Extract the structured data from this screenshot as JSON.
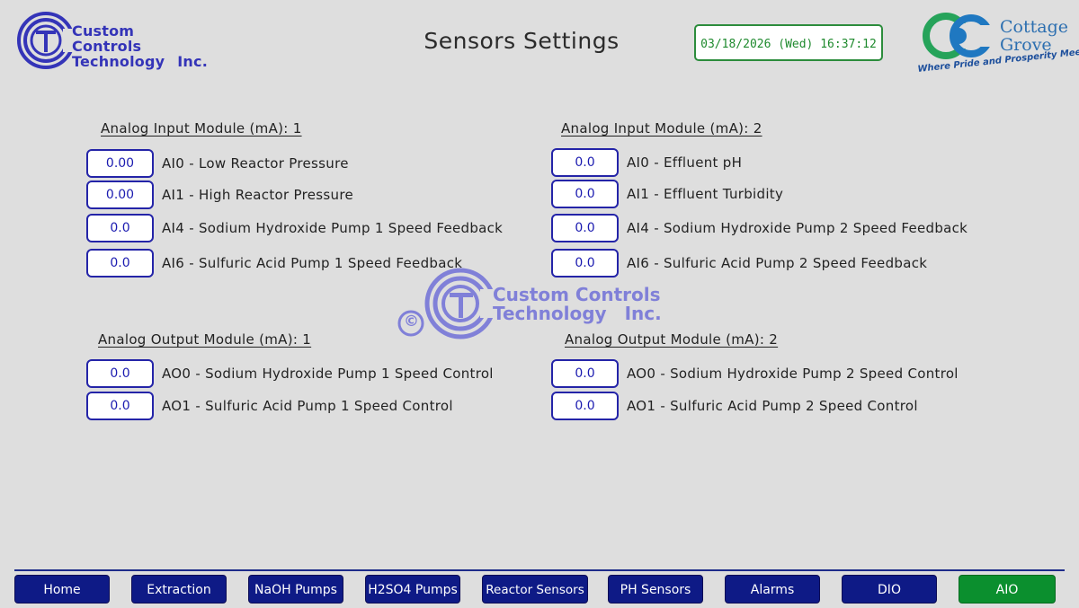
{
  "header": {
    "company_logo": {
      "line1": "Custom Controls",
      "line2": "Technology",
      "line3": "Inc."
    },
    "title": "Sensors Settings",
    "datetime": "03/18/2026 (Wed) 16:37:12",
    "partner_logo": {
      "line1": "Cottage",
      "line2": "Grove",
      "tagline": "Where Pride and Prosperity Meet"
    }
  },
  "analog_input_1": {
    "title": "Analog Input Module (mA): 1",
    "fields": [
      {
        "value": "0.00",
        "label": "AI0 - Low Reactor Pressure"
      },
      {
        "value": "0.00",
        "label": "AI1 - High Reactor Pressure"
      },
      {
        "value": "0.0",
        "label": "AI4 - Sodium Hydroxide Pump 1 Speed Feedback"
      },
      {
        "value": "0.0",
        "label": "AI6 - Sulfuric Acid Pump 1 Speed Feedback"
      }
    ]
  },
  "analog_input_2": {
    "title": "Analog Input Module (mA): 2",
    "fields": [
      {
        "value": "0.0",
        "label": "AI0 - Effluent pH"
      },
      {
        "value": "0.0",
        "label": "AI1 - Effluent Turbidity"
      },
      {
        "value": "0.0",
        "label": "AI4 - Sodium Hydroxide Pump 2 Speed Feedback"
      },
      {
        "value": "0.0",
        "label": "AI6 - Sulfuric Acid Pump 2 Speed Feedback"
      }
    ]
  },
  "analog_output_1": {
    "title": "Analog Output Module (mA): 1",
    "fields": [
      {
        "value": "0.0",
        "label": "AO0 - Sodium Hydroxide Pump 1 Speed Control"
      },
      {
        "value": "0.0",
        "label": "AO1 - Sulfuric Acid Pump 1 Speed Control"
      }
    ]
  },
  "analog_output_2": {
    "title": "Analog Output Module (mA): 2",
    "fields": [
      {
        "value": "0.0",
        "label": "AO0 - Sodium Hydroxide Pump 2 Speed Control"
      },
      {
        "value": "0.0",
        "label": "AO1 - Sulfuric Acid Pump 2 Speed Control"
      }
    ]
  },
  "watermark": {
    "copyright": "©",
    "line1": "Custom Controls",
    "line2": "Technology",
    "line3": "Inc."
  },
  "nav": {
    "items": [
      {
        "label": "Home"
      },
      {
        "label": "Extraction"
      },
      {
        "label": "NaOH Pumps"
      },
      {
        "label": "H2SO4 Pumps"
      },
      {
        "label": "Reactor Sensors"
      },
      {
        "label": "PH Sensors"
      },
      {
        "label": "Alarms"
      },
      {
        "label": "DIO"
      },
      {
        "label": "AIO"
      }
    ],
    "active": "AIO"
  },
  "colors": {
    "background": "#dedede",
    "field_border": "#2424a8",
    "nav_button": "#0e1a86",
    "nav_active": "#0b8f2e",
    "datetime_text": "#1f8a2e"
  }
}
